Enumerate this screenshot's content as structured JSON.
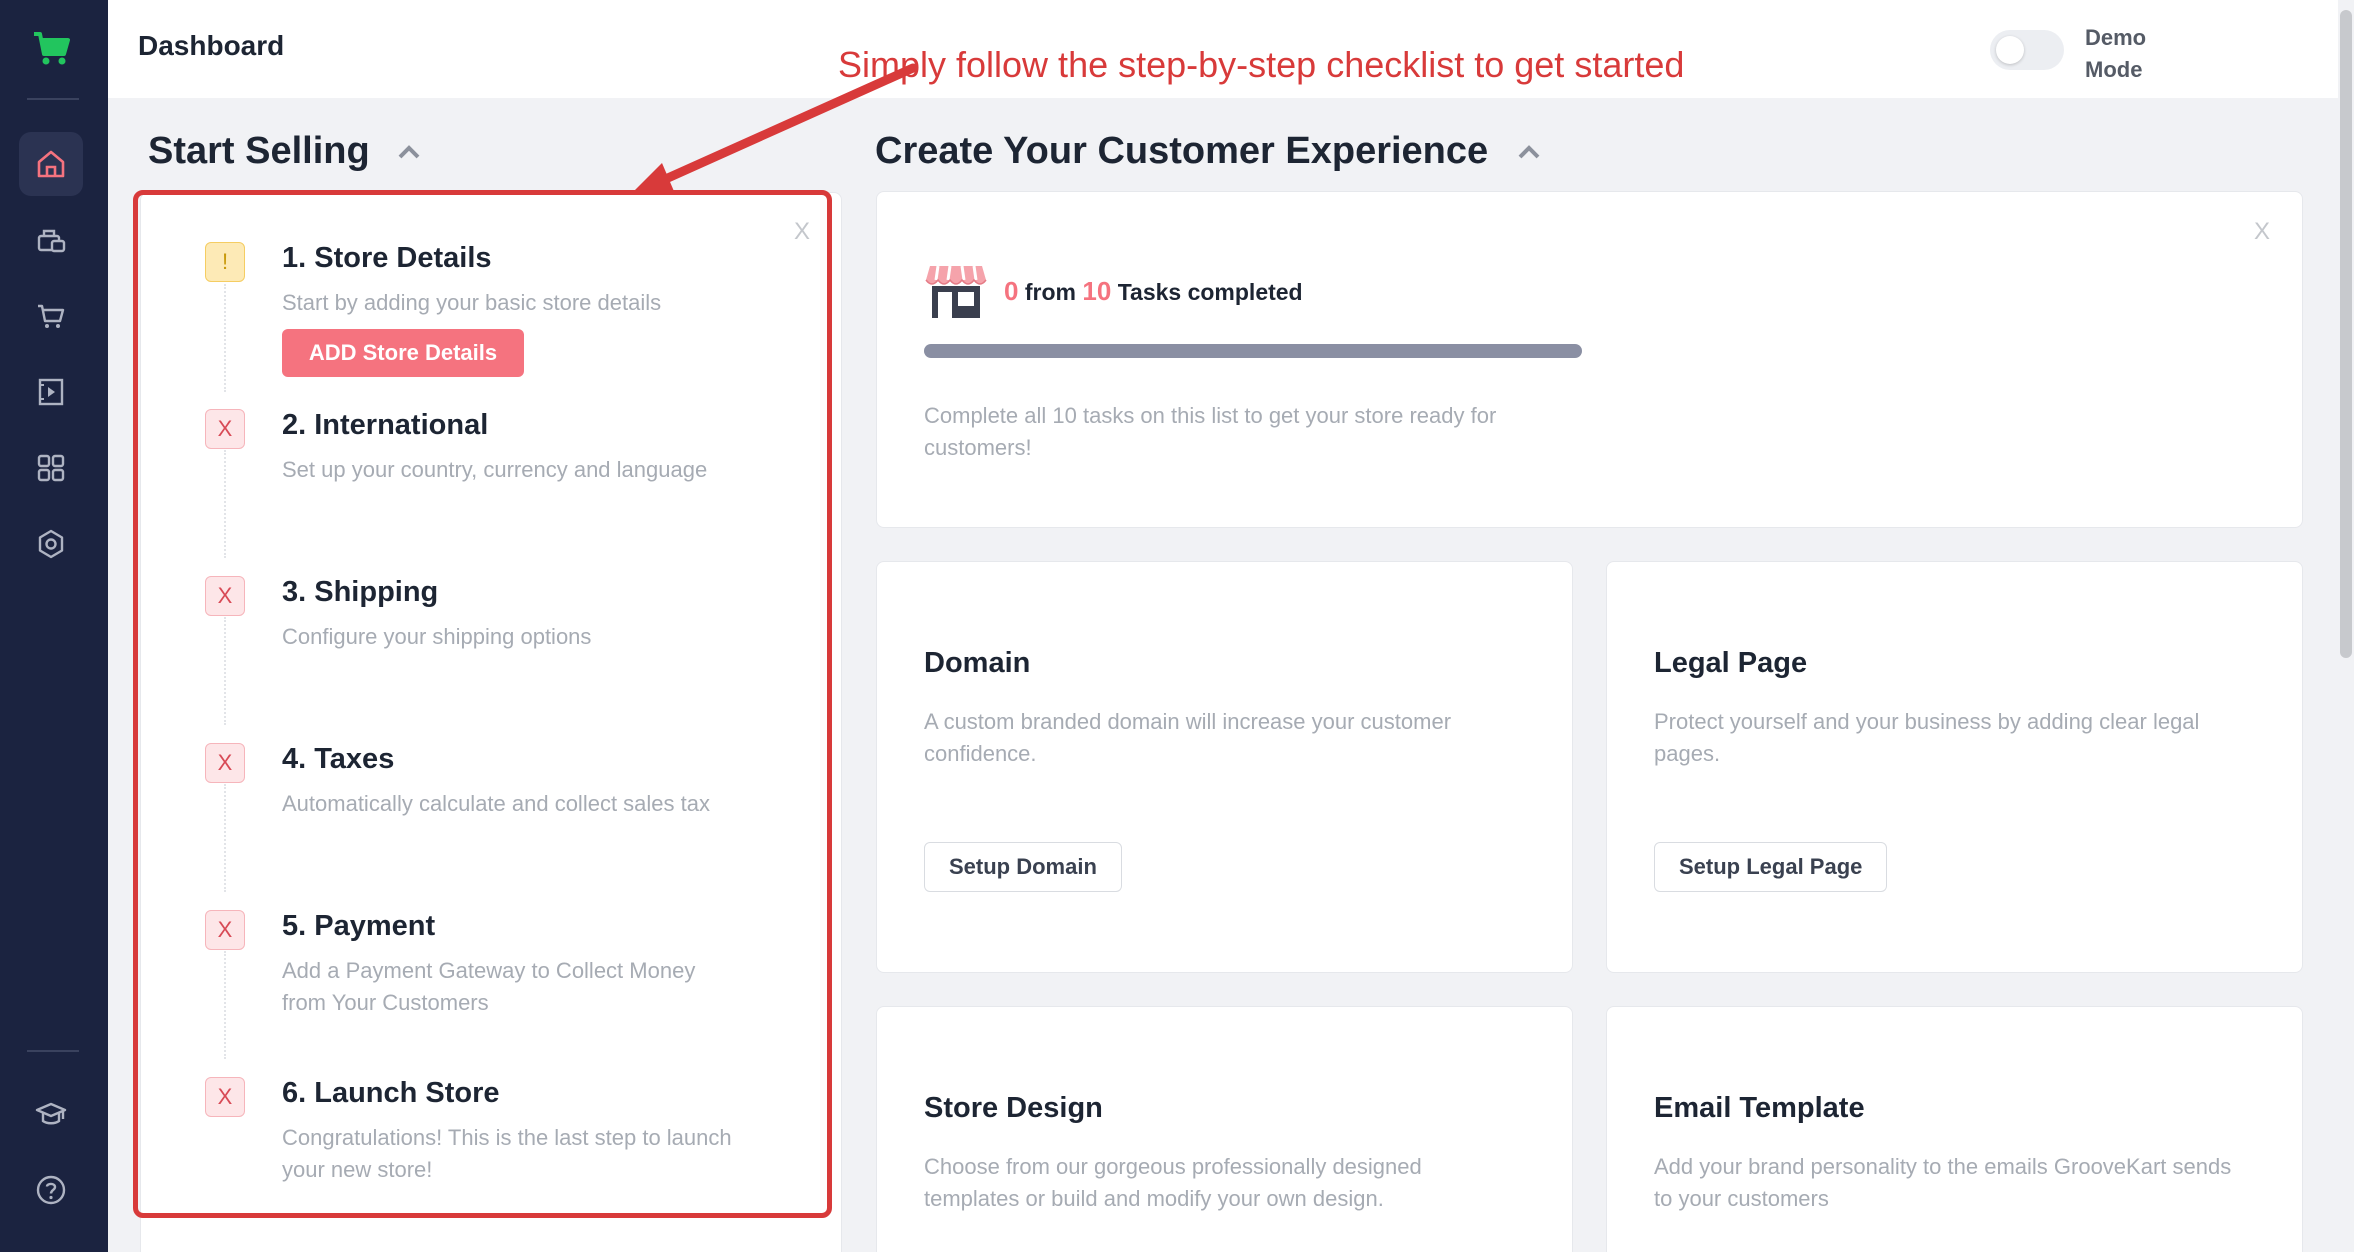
{
  "header": {
    "title": "Dashboard",
    "annotation": "Simply follow the step-by-step checklist to get started",
    "demo_mode_label": "Demo Mode"
  },
  "sidebar": {
    "items": [
      {
        "name": "home",
        "icon": "home-icon",
        "active": true
      },
      {
        "name": "products",
        "icon": "products-icon"
      },
      {
        "name": "orders",
        "icon": "cart-icon"
      },
      {
        "name": "funnels",
        "icon": "pages-icon"
      },
      {
        "name": "apps",
        "icon": "grid-icon"
      },
      {
        "name": "settings",
        "icon": "settings-icon"
      },
      {
        "name": "academy",
        "icon": "graduation-cap-icon"
      },
      {
        "name": "help",
        "icon": "help-icon"
      }
    ]
  },
  "start_selling": {
    "title": "Start Selling",
    "close_label": "X",
    "steps": [
      {
        "title": "1. Store Details",
        "description": "Start by adding your basic store details",
        "status": "!",
        "status_type": "warning",
        "button": "ADD Store Details"
      },
      {
        "title": "2. International",
        "description": "Set up your country, currency and language",
        "status": "X",
        "status_type": "incomplete"
      },
      {
        "title": "3. Shipping",
        "description": "Configure your shipping options",
        "status": "X",
        "status_type": "incomplete"
      },
      {
        "title": "4. Taxes",
        "description": "Automatically calculate and collect sales tax",
        "status": "X",
        "status_type": "incomplete"
      },
      {
        "title": "5. Payment",
        "description": "Add a Payment Gateway to Collect Money from Your Customers",
        "status": "X",
        "status_type": "incomplete"
      },
      {
        "title": "6. Launch Store",
        "description": "Congratulations! This is the last step to launch your new store!",
        "status": "X",
        "status_type": "incomplete"
      }
    ]
  },
  "customer_experience": {
    "title": "Create Your Customer Experience",
    "close_label": "X",
    "tasks": {
      "completed": "0",
      "from_label": "from",
      "total": "10",
      "suffix": "Tasks completed",
      "progress": 0,
      "description": "Complete all 10 tasks on this list to get your store ready for customers!"
    },
    "cards": [
      {
        "title": "Domain",
        "description": "A custom branded domain will increase your customer confidence.",
        "button": "Setup Domain"
      },
      {
        "title": "Legal Page",
        "description": "Protect yourself and your business by adding clear legal pages.",
        "button": "Setup Legal Page"
      },
      {
        "title": "Store Design",
        "description": "Choose from our gorgeous professionally designed templates or build and modify your own design."
      },
      {
        "title": "Email Template",
        "description": "Add your brand personality to the emails GrooveKart sends to your customers"
      }
    ]
  },
  "colors": {
    "sidebar_bg": "#1b2340",
    "accent_pink": "#f5737f",
    "annotation_red": "#d83a3a",
    "logo_green": "#22c55e"
  }
}
